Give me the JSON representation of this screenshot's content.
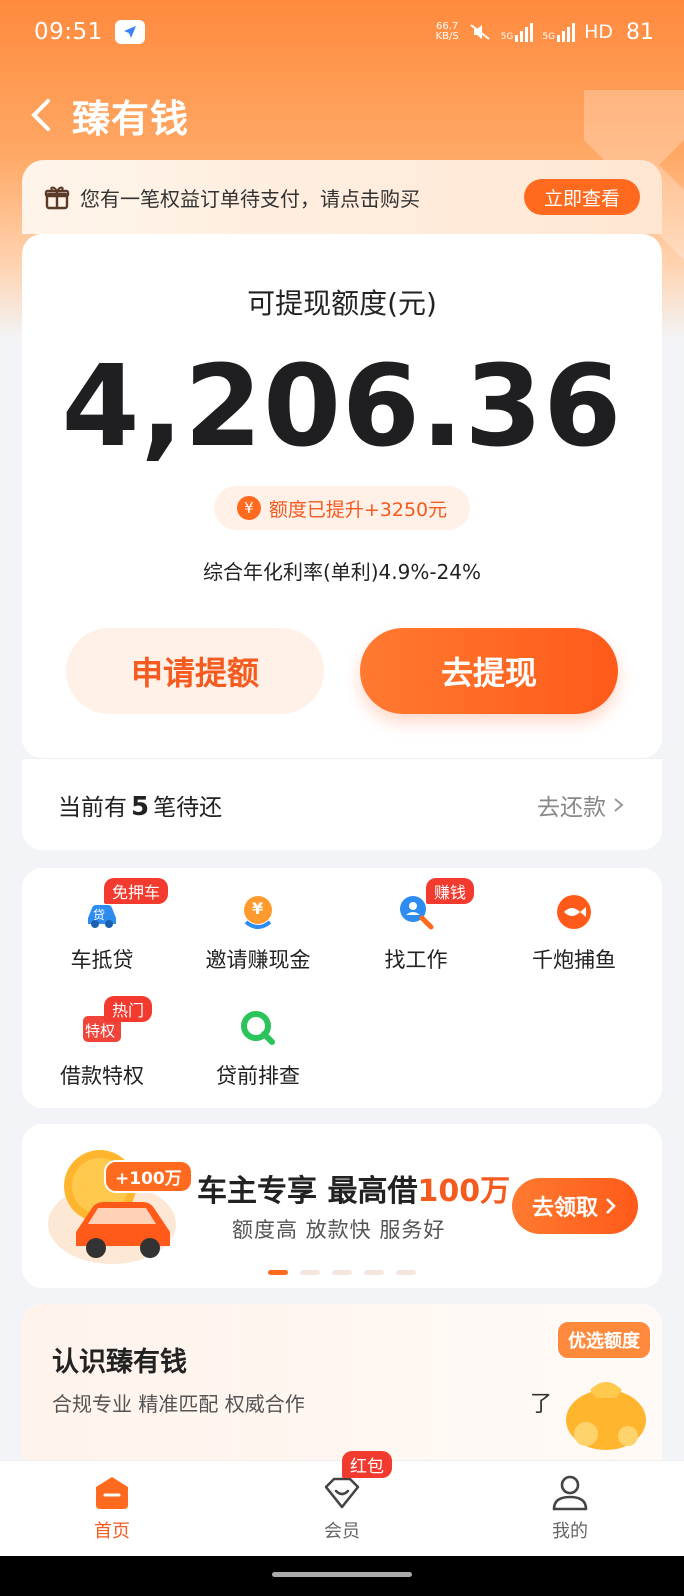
{
  "status_bar": {
    "time": "09:51",
    "net_speed_value": "66.7",
    "net_speed_unit": "KB/S",
    "network": "5G",
    "hd": "HD",
    "battery": "81"
  },
  "header": {
    "title": "臻有钱",
    "back_icon": "chevron-left-icon"
  },
  "notice": {
    "text": "您有一笔权益订单待支付，请点击购买",
    "button": "立即查看",
    "icon": "gift-icon"
  },
  "credit": {
    "label": "可提现额度(元)",
    "amount": "4,206.36",
    "raise_text": "额度已提升+3250元",
    "yen_glyph": "¥",
    "rate": "综合年化利率(单利)4.9%-24%",
    "apply_button": "申请提额",
    "withdraw_button": "去提现"
  },
  "repay": {
    "prefix": "当前有",
    "count": "5",
    "suffix": "笔待还",
    "link": "去还款"
  },
  "services": [
    {
      "label": "车抵贷",
      "tag": "免押车",
      "icon": "car-loan-icon",
      "icon_text": "贷"
    },
    {
      "label": "邀请赚现金",
      "tag": "",
      "icon": "invite-cash-icon",
      "icon_text": "¥"
    },
    {
      "label": "找工作",
      "tag": "赚钱",
      "icon": "job-search-icon",
      "icon_text": ""
    },
    {
      "label": "千炮捕鱼",
      "tag": "",
      "icon": "fish-game-icon",
      "icon_text": ""
    },
    {
      "label": "借款特权",
      "tag": "热门",
      "icon": "loan-privilege-icon",
      "icon_text": "特权"
    },
    {
      "label": "贷前排查",
      "tag": "",
      "icon": "pre-loan-check-icon",
      "icon_text": ""
    }
  ],
  "banner": {
    "badge": "+100万",
    "title_prefix": "车主专享 最高借",
    "title_highlight": "100万",
    "subtitle": "额度高 放款快 服务好",
    "button": "去领取"
  },
  "intro": {
    "title": "认识臻有钱",
    "subtitle": "合规专业 精准匹配 权威合作",
    "trailing": "了",
    "stamp": "优选额度"
  },
  "tabbar": {
    "home": "首页",
    "member": "会员",
    "member_badge": "红包",
    "mine": "我的"
  },
  "colors": {
    "accent": "#ff6a1f",
    "tag_red": "#f23a2e",
    "text_orange": "#f55a1e"
  }
}
